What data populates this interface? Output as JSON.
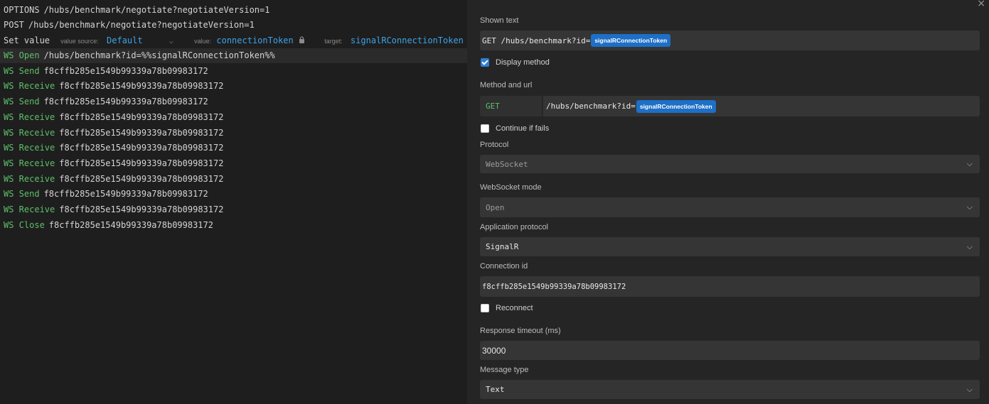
{
  "requests": [
    {
      "method": "OPTIONS",
      "url": "/hubs/benchmark/negotiate?negotiateVersion=1",
      "color": "plain"
    },
    {
      "method": "POST",
      "url": "/hubs/benchmark/negotiate?negotiateVersion=1",
      "color": "plain"
    }
  ],
  "set_value": {
    "label": "Set value",
    "source_label": "value source:",
    "source_value": "Default",
    "value_label": "value:",
    "value": "connectionToken",
    "target_label": "target:",
    "target": "signalRConnectionToken"
  },
  "ws_rows": [
    {
      "method": "WS Open",
      "url": "/hubs/benchmark?id=%%signalRConnectionToken%%",
      "selected": true
    },
    {
      "method": "WS Send",
      "url": "f8cffb285e1549b99339a78b09983172"
    },
    {
      "method": "WS Receive",
      "url": "f8cffb285e1549b99339a78b09983172"
    },
    {
      "method": "WS Send",
      "url": "f8cffb285e1549b99339a78b09983172"
    },
    {
      "method": "WS Receive",
      "url": "f8cffb285e1549b99339a78b09983172"
    },
    {
      "method": "WS Receive",
      "url": "f8cffb285e1549b99339a78b09983172"
    },
    {
      "method": "WS Receive",
      "url": "f8cffb285e1549b99339a78b09983172"
    },
    {
      "method": "WS Receive",
      "url": "f8cffb285e1549b99339a78b09983172"
    },
    {
      "method": "WS Receive",
      "url": "f8cffb285e1549b99339a78b09983172"
    },
    {
      "method": "WS Send",
      "url": "f8cffb285e1549b99339a78b09983172"
    },
    {
      "method": "WS Receive",
      "url": "f8cffb285e1549b99339a78b09983172"
    },
    {
      "method": "WS Close",
      "url": "f8cffb285e1549b99339a78b09983172"
    }
  ],
  "panel": {
    "close": "×",
    "shown_text_label": "Shown text",
    "shown_text_prefix": "GET /hubs/benchmark?id=",
    "shown_text_chip": "signalRConnectionToken",
    "display_method_label": "Display method",
    "display_method_checked": true,
    "method_url_label": "Method and url",
    "method": "GET",
    "url_prefix": "/hubs/benchmark?id=",
    "url_chip": "signalRConnectionToken",
    "continue_label": "Continue if fails",
    "continue_checked": false,
    "protocol_label": "Protocol",
    "protocol_value": "WebSocket",
    "ws_mode_label": "WebSocket mode",
    "ws_mode_value": "Open",
    "app_protocol_label": "Application protocol",
    "app_protocol_value": "SignalR",
    "connection_id_label": "Connection id",
    "connection_id_value": "f8cffb285e1549b99339a78b09983172",
    "reconnect_label": "Reconnect",
    "reconnect_checked": false,
    "timeout_label": "Response timeout (ms)",
    "timeout_value": "30000",
    "message_type_label": "Message type",
    "message_type_value": "Text"
  },
  "colors": {
    "method_green": "#5fbf6a",
    "accent_blue": "#3da3e8",
    "chip_blue": "#1d6fc7"
  }
}
